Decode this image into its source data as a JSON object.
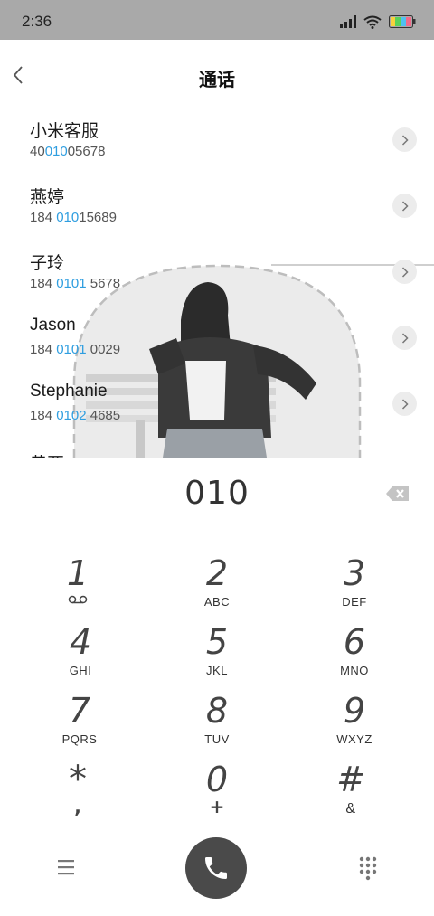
{
  "status": {
    "time": "2:36"
  },
  "header": {
    "title": "通话"
  },
  "search_results": [
    {
      "name": "小米客服",
      "number_pre": "40",
      "number_match": "010",
      "number_post": "05678"
    },
    {
      "name": "燕婷",
      "number_pre": "184 ",
      "number_match": "010",
      "number_post": "15689"
    },
    {
      "name": "子玲",
      "number_pre": "184 ",
      "number_match": "0101",
      "number_post": " 5678"
    },
    {
      "name": "Jason",
      "number_pre": "184 ",
      "number_match": "0101",
      "number_post": " 0029"
    },
    {
      "name": "Stephanie",
      "number_pre": "184 ",
      "number_match": "0102",
      "number_post": " 4685"
    }
  ],
  "partial_row_name": "黄亚",
  "dialer": {
    "entered_number": "010"
  },
  "keypad": {
    "keys": [
      {
        "digit": "1",
        "letters": ""
      },
      {
        "digit": "2",
        "letters": "ABC"
      },
      {
        "digit": "3",
        "letters": "DEF"
      },
      {
        "digit": "4",
        "letters": "GHI"
      },
      {
        "digit": "5",
        "letters": "JKL"
      },
      {
        "digit": "6",
        "letters": "MNO"
      },
      {
        "digit": "7",
        "letters": "PQRS"
      },
      {
        "digit": "8",
        "letters": "TUV"
      },
      {
        "digit": "9",
        "letters": "WXYZ"
      },
      {
        "digit": "*",
        "letters": ","
      },
      {
        "digit": "0",
        "letters": "+"
      },
      {
        "digit": "#",
        "letters": "&"
      }
    ]
  },
  "icons": {
    "back": "chevron-left-icon",
    "detail": "chevron-right-icon",
    "backspace": "backspace-icon",
    "voicemail": "voicemail-icon",
    "menu": "menu-icon",
    "call": "phone-icon",
    "dialpad": "dialpad-icon"
  },
  "colors": {
    "match_highlight": "#2f9ee0",
    "status_bar": "#a9a9a9",
    "call_button": "#4a4a4a"
  }
}
